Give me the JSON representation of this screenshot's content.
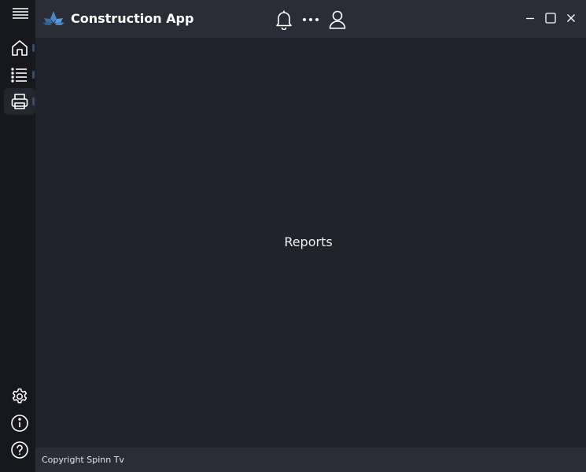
{
  "window": {
    "title": "Construction App",
    "controls": {
      "minimize_icon": "minimize-icon",
      "maximize_icon": "maximize-icon",
      "close_icon": "close-icon"
    }
  },
  "titlebar": {
    "logo_icon": "lotus-logo-icon",
    "notification_icon": "bell-icon",
    "more_icon": "ellipsis-icon",
    "profile_icon": "user-icon"
  },
  "sidebar": {
    "menu_icon": "hamburger-icon",
    "items": [
      {
        "id": "home",
        "icon": "home-icon",
        "active": false
      },
      {
        "id": "list",
        "icon": "list-icon",
        "active": false
      },
      {
        "id": "reports",
        "icon": "printer-icon",
        "active": true
      }
    ],
    "bottom_items": [
      {
        "id": "settings",
        "icon": "gear-icon"
      },
      {
        "id": "info",
        "icon": "info-icon"
      },
      {
        "id": "help",
        "icon": "help-icon"
      }
    ]
  },
  "main": {
    "page_label": "Reports"
  },
  "footer": {
    "copyright": "Copyright Spinn Tv"
  },
  "colors": {
    "rail_bg": "#16181d",
    "titlebar_bg": "#2a2d38",
    "content_bg": "#20232c",
    "accent": "#2b4f7a",
    "logo_blue": "#4a86c5"
  }
}
